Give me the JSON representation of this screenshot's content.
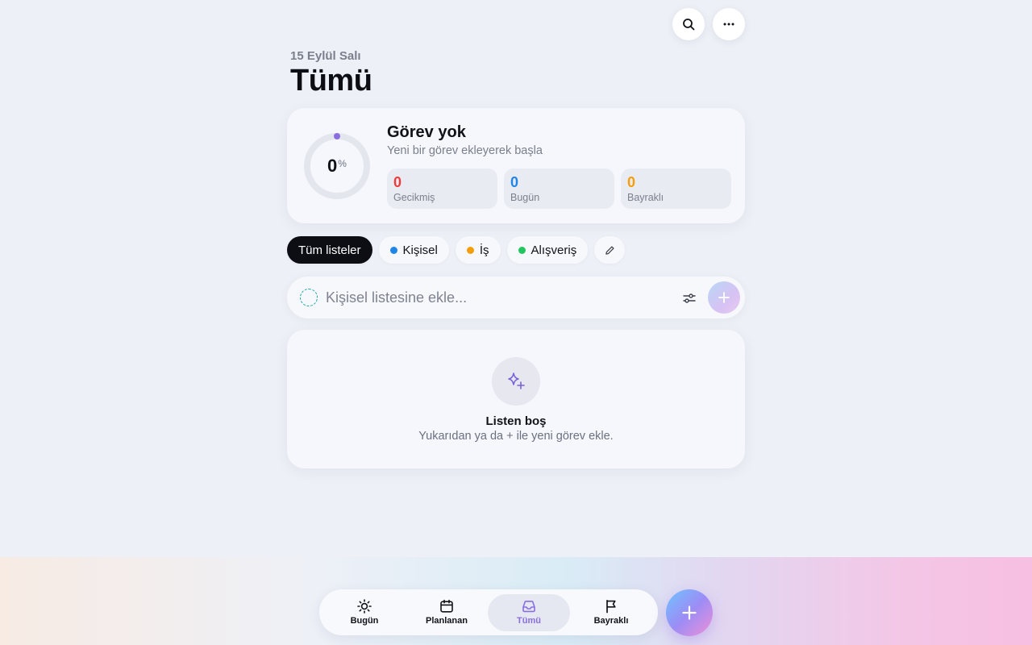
{
  "header": {
    "date": "15 Eylül Salı",
    "title": "Tümü"
  },
  "top_actions": [
    {
      "icon": "search-icon"
    },
    {
      "icon": "more-icon"
    }
  ],
  "summary": {
    "progress_value": "0",
    "progress_unit": "%",
    "progress_fraction": 0,
    "title": "Görev yok",
    "subtitle": "Yeni bir görev ekleyerek başla",
    "stats": [
      {
        "value": "0",
        "label": "Gecikmiş",
        "color": "#ef3b3b"
      },
      {
        "value": "0",
        "label": "Bugün",
        "color": "#1f86e8"
      },
      {
        "value": "0",
        "label": "Bayraklı",
        "color": "#f59e0b"
      }
    ]
  },
  "lists": {
    "all_label": "Tüm listeler",
    "items": [
      {
        "label": "Kişisel",
        "color": "#1f86e8"
      },
      {
        "label": "İş",
        "color": "#f59e0b"
      },
      {
        "label": "Alışveriş",
        "color": "#22c55e"
      }
    ]
  },
  "add_task": {
    "placeholder": "Kişisel listesine ekle...",
    "value": ""
  },
  "empty_state": {
    "title": "Listen boş",
    "subtitle": "Yukarıdan ya da + ile yeni görev ekle."
  },
  "bottom_nav": {
    "items": [
      {
        "label": "Bugün",
        "icon": "sun-icon"
      },
      {
        "label": "Planlanan",
        "icon": "calendar-icon"
      },
      {
        "label": "Tümü",
        "icon": "inbox-icon",
        "active": true
      },
      {
        "label": "Bayraklı",
        "icon": "flag-icon"
      }
    ]
  },
  "colors": {
    "accent": "#8a6ee0",
    "background": "#eef0f7"
  }
}
